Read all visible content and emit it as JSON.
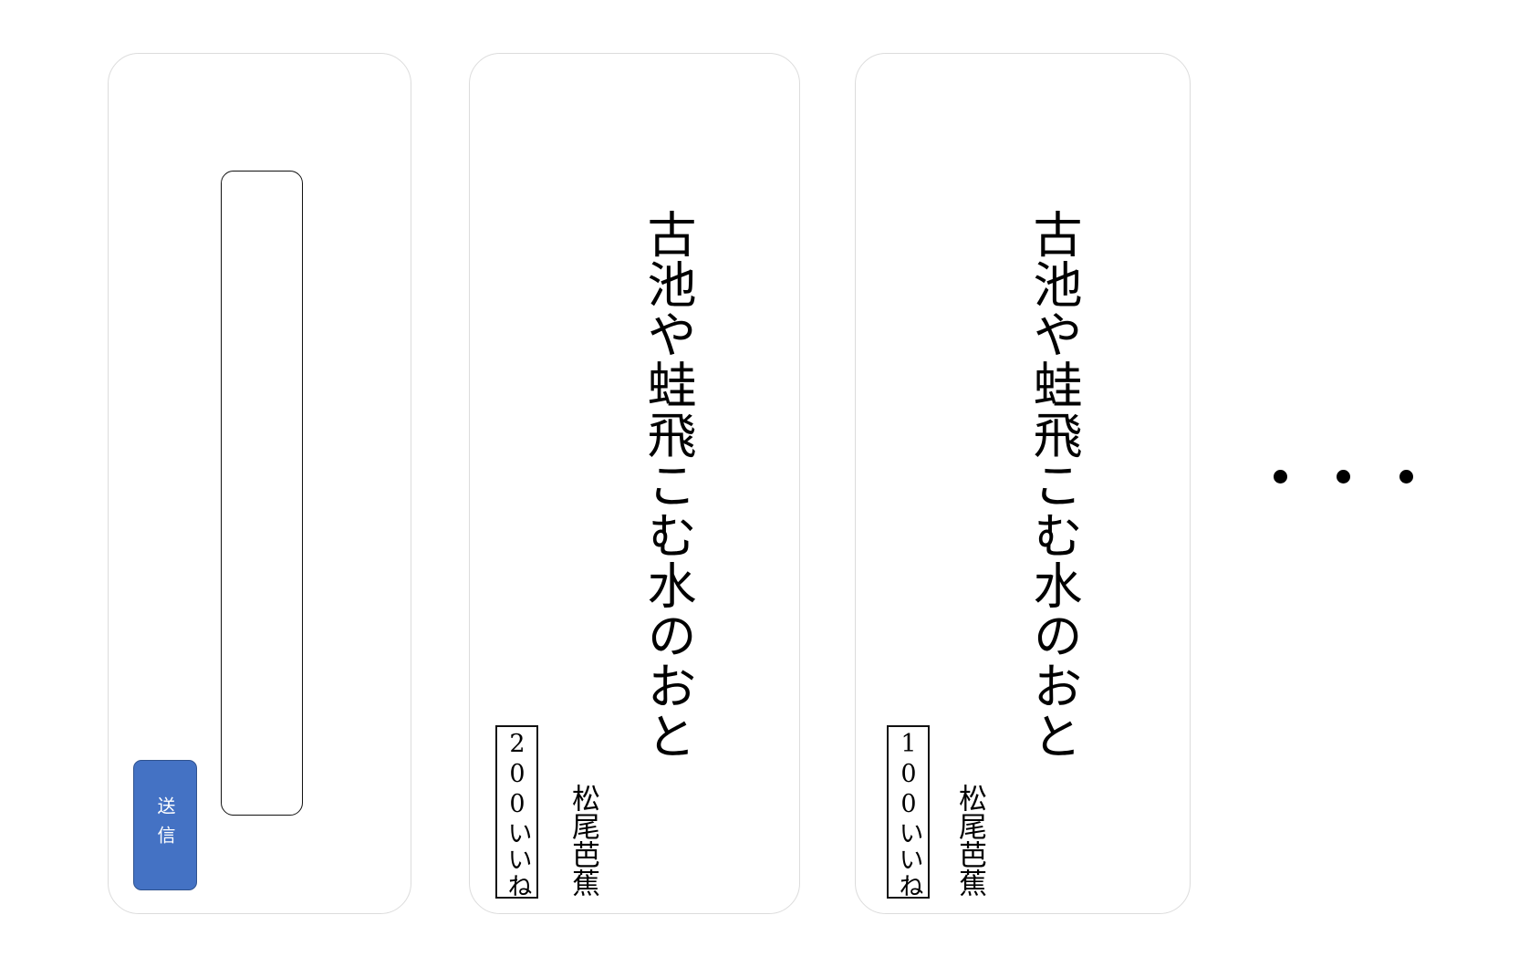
{
  "compose": {
    "input_value": "",
    "send_label": "送信"
  },
  "posts": [
    {
      "text": "古池や蛙飛こむ水のおと",
      "author": "松尾芭蕉",
      "likes": "200いいね"
    },
    {
      "text": "古池や蛙飛こむ水のおと",
      "author": "松尾芭蕉",
      "likes": "100いいね"
    }
  ],
  "colors": {
    "send_button": "#4472c4",
    "card_border": "#dcdcdc"
  },
  "icons": {
    "more": "ellipsis-icon"
  }
}
